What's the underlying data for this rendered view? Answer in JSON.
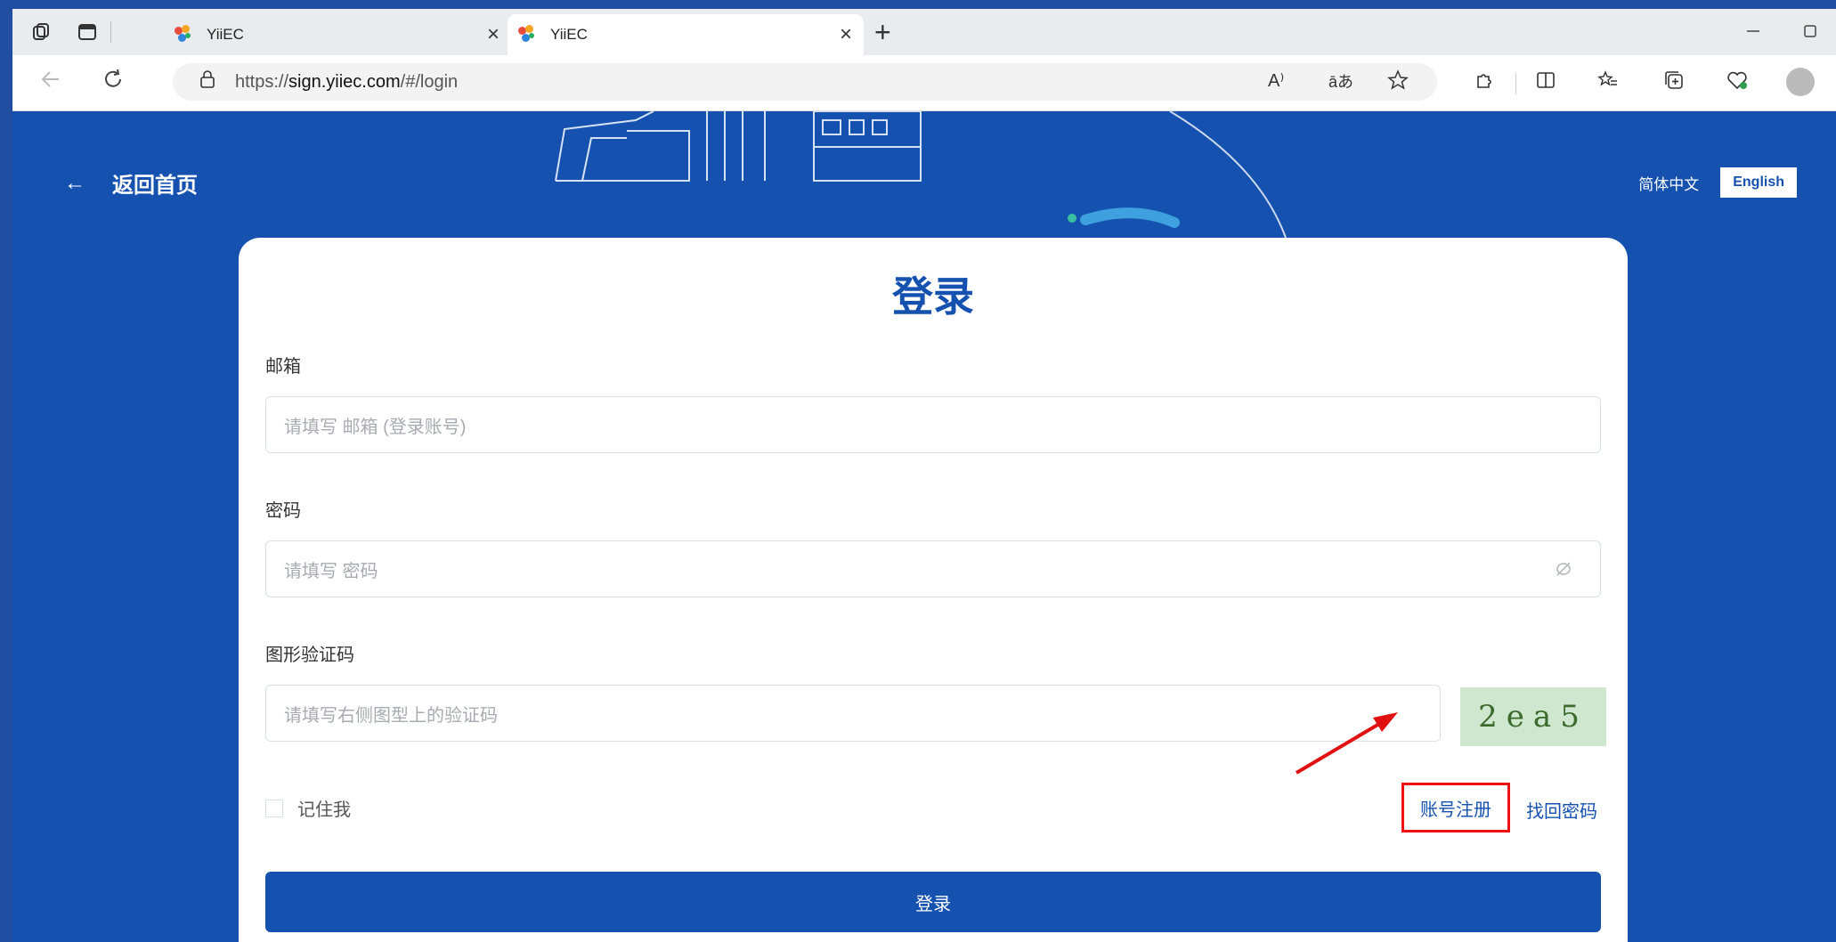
{
  "browser": {
    "tabs": [
      {
        "title": "YiiEC",
        "close": "×"
      },
      {
        "title": "YiiEC",
        "close": "×"
      }
    ],
    "new_tab": "+",
    "url_prefix": "https://",
    "url_host": "sign.yiiec.com",
    "url_path": "/#/login",
    "read_aloud_label": "A⁾",
    "translate_label": "āあ"
  },
  "header": {
    "back_label": "返回首页",
    "lang_zh": "简体中文",
    "lang_en": "English"
  },
  "login": {
    "title": "登录",
    "email_label": "邮箱",
    "email_placeholder": "请填写 邮箱 (登录账号)",
    "password_label": "密码",
    "password_placeholder": "请填写 密码",
    "captcha_label": "图形验证码",
    "captcha_placeholder": "请填写右侧图型上的验证码",
    "captcha_text": "2ea5",
    "remember_label": "记住我",
    "register_link": "账号注册",
    "forgot_link": "找回密码",
    "submit_label": "登录"
  },
  "colors": {
    "brand": "#1552b0",
    "highlight": "#e11111"
  }
}
